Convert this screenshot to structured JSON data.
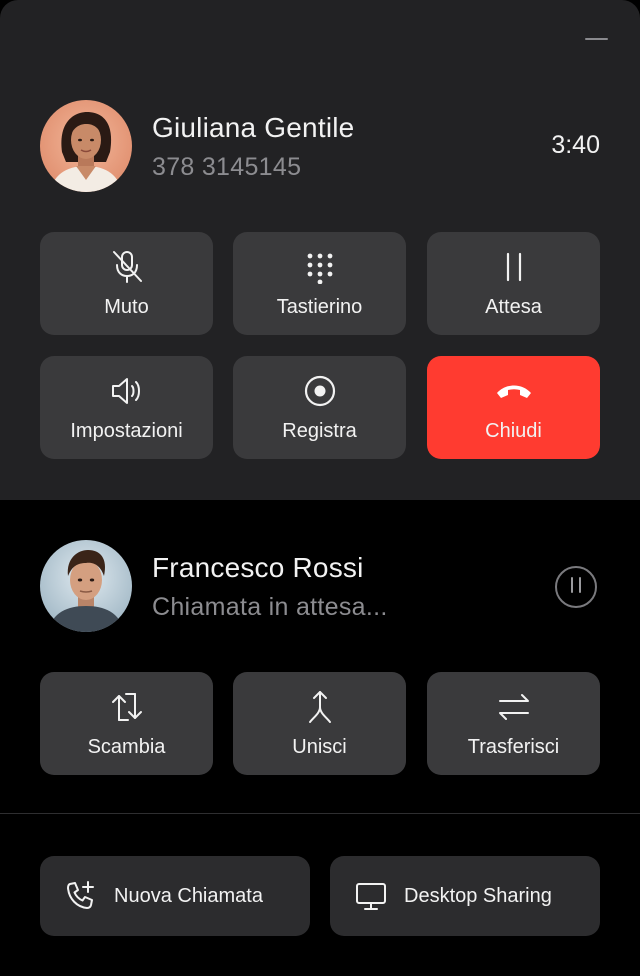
{
  "active_call": {
    "name": "Giuliana Gentile",
    "number": "378 3145145",
    "duration": "3:40",
    "buttons": {
      "mute": "Muto",
      "keypad": "Tastierino",
      "hold": "Attesa",
      "settings": "Impostazioni",
      "record": "Registra",
      "hangup": "Chiudi"
    }
  },
  "held_call": {
    "name": "Francesco Rossi",
    "status": "Chiamata in attesa...",
    "buttons": {
      "swap": "Scambia",
      "merge": "Unisci",
      "transfer": "Trasferisci"
    }
  },
  "footer": {
    "new_call": "Nuova Chiamata",
    "desktop_sharing": "Desktop Sharing"
  },
  "colors": {
    "active_bg": "#222224",
    "held_bg": "#000000",
    "button_bg": "#3a3a3c",
    "hangup": "#ff3b30",
    "secondary_text": "#8c8c90"
  },
  "icons": {
    "mute": "mic-off-icon",
    "keypad": "keypad-icon",
    "hold": "pause-icon",
    "settings": "speaker-icon",
    "record": "record-icon",
    "hangup": "phone-hangup-icon",
    "swap": "swap-icon",
    "merge": "merge-icon",
    "transfer": "transfer-icon",
    "new_call": "phone-add-icon",
    "desktop_sharing": "monitor-icon"
  }
}
